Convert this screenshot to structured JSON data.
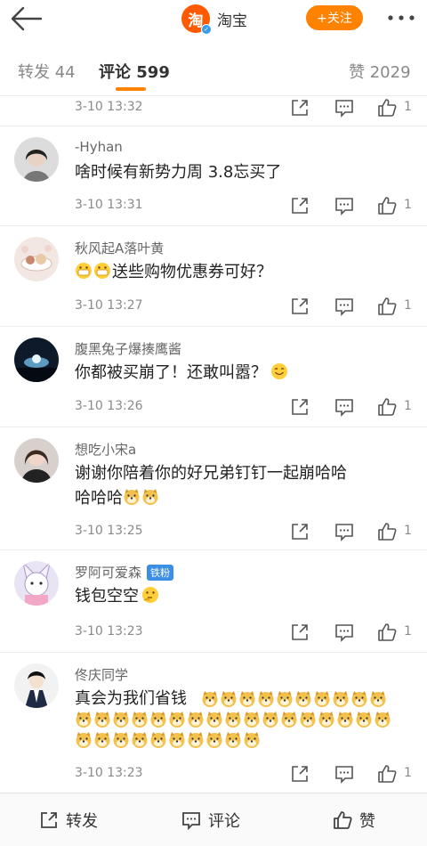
{
  "header": {
    "back_icon": "back-arrow-icon",
    "logo_text": "淘",
    "account_name": "淘宝",
    "follow_label": "+关注",
    "more_icon": "more-dots-icon"
  },
  "tabs": {
    "repost": "转发 44",
    "comments": "评论 599",
    "likes": "赞 2029"
  },
  "comments": [
    {
      "name": "",
      "text": "",
      "time": "3-10 13:32",
      "likes": "1"
    },
    {
      "name": "-Hyhan",
      "text": "啥时候有新势力周 3.8忘买了",
      "time": "3-10 13:31",
      "likes": "1"
    },
    {
      "name": "秋风起A落叶黄",
      "text": "送些购物优惠券可好？",
      "time": "3-10 13:27",
      "likes": "1"
    },
    {
      "name": "腹黑兔子爆揍鹰酱",
      "text": "你都被买崩了！还敢叫嚣？",
      "time": "3-10 13:26",
      "likes": "1"
    },
    {
      "name": "想吃小宋a",
      "text": "谢谢你陪着你的好兄弟钉钉一起崩哈哈",
      "text2": "哈哈哈",
      "time": "3-10 13:25",
      "likes": "1"
    },
    {
      "name": "罗阿可爱森",
      "badge": "铁粉",
      "text": "钱包空空",
      "time": "3-10 13:23",
      "likes": "1"
    },
    {
      "name": "佟庆同学",
      "text": "真会为我们省钱",
      "time": "3-10 13:23",
      "likes": "1"
    }
  ],
  "bottom_bar": {
    "repost_label": "转发",
    "comment_label": "评论",
    "like_label": "赞"
  },
  "colors": {
    "accent": "#ff8200",
    "brand": "#ff5a00",
    "badge": "#3d8fe6"
  }
}
